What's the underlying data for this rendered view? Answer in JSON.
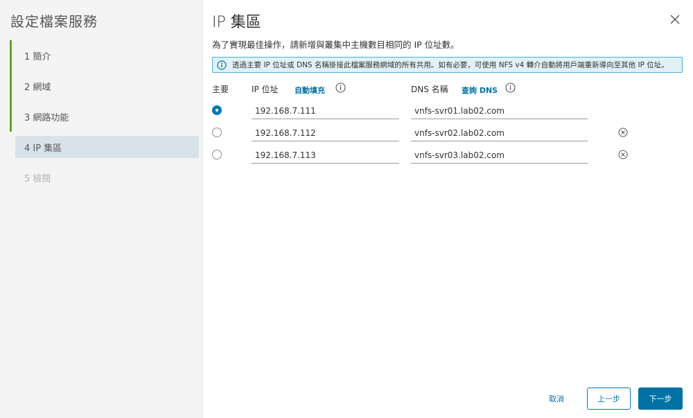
{
  "wizard": {
    "title": "設定檔案服務",
    "steps": [
      {
        "label": "1  簡介",
        "state": "completed"
      },
      {
        "label": "2  網域",
        "state": "completed"
      },
      {
        "label": "3  網路功能",
        "state": "completed"
      },
      {
        "label": "4  IP 集區",
        "state": "current"
      },
      {
        "label": "5  檢閱",
        "state": "disabled"
      }
    ]
  },
  "page": {
    "title": "IP 集區",
    "subtitle": "為了實現最佳操作，請新增與叢集中主機數目相同的 IP 位址數。",
    "info_banner": "透過主要 IP 位址或 DNS 名稱掛接此檔案服務網域的所有共用。如有必要，可使用 NFS v4 轉介自動將用戶端重新導向至其他 IP 位址。"
  },
  "table": {
    "col_primary": "主要",
    "col_ip": "IP 位址",
    "autofill_link": "自動填充",
    "col_dns": "DNS 名稱",
    "lookup_dns_link": "查詢 DNS",
    "rows": [
      {
        "ip": "192.168.7.111",
        "dns": "vnfs-svr01.lab02.com",
        "primary": true
      },
      {
        "ip": "192.168.7.112",
        "dns": "vnfs-svr02.lab02.com",
        "primary": false
      },
      {
        "ip": "192.168.7.113",
        "dns": "vnfs-svr03.lab02.com",
        "primary": false
      }
    ]
  },
  "footer": {
    "cancel_label": "取消",
    "back_label": "上一步",
    "next_label": "下一步"
  },
  "icons": {
    "close": "close-icon",
    "info": "info-circle-icon",
    "remove": "remove-circle-icon"
  },
  "colors": {
    "accent": "#0072a3",
    "completed_step": "#62a420",
    "current_step_bg": "#d8e3e9",
    "info_banner_bg": "#e1f1f6",
    "info_banner_border": "#49afd9"
  }
}
